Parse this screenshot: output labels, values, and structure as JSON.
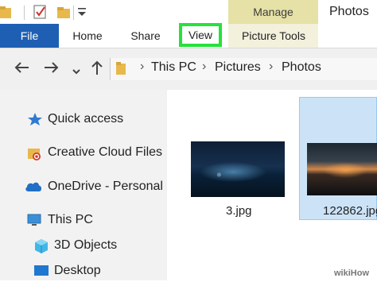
{
  "window": {
    "title": "Photos"
  },
  "contextual": {
    "manage": "Manage"
  },
  "ribbon": {
    "tabs": [
      {
        "label": "File"
      },
      {
        "label": "Home"
      },
      {
        "label": "Share"
      },
      {
        "label": "View"
      },
      {
        "label": "Picture Tools"
      }
    ],
    "highlight_color": "#27e13a",
    "file_tab_color": "#1e5fb4",
    "manage_color": "#e6e1a6"
  },
  "toolbar": {
    "back_icon": "arrow-left-icon",
    "forward_icon": "arrow-right-icon",
    "recent_icon": "chevron-down-icon",
    "up_icon": "arrow-up-icon"
  },
  "address": {
    "crumbs": [
      "This PC",
      "Pictures",
      "Photos"
    ],
    "separator": "›"
  },
  "navigation": {
    "items": [
      {
        "label": "Quick access",
        "icon": "star-icon"
      },
      {
        "label": "Creative Cloud Files",
        "icon": "cc-folder-icon"
      },
      {
        "label": "OneDrive - Personal",
        "icon": "cloud-icon"
      },
      {
        "label": "This PC",
        "icon": "computer-icon"
      },
      {
        "label": "3D Objects",
        "icon": "cube-icon"
      },
      {
        "label": "Desktop",
        "icon": "desktop-icon"
      }
    ]
  },
  "files": [
    {
      "name": "3.jpg"
    },
    {
      "name": "122862.jpg"
    }
  ],
  "watermark": "wikiHow"
}
